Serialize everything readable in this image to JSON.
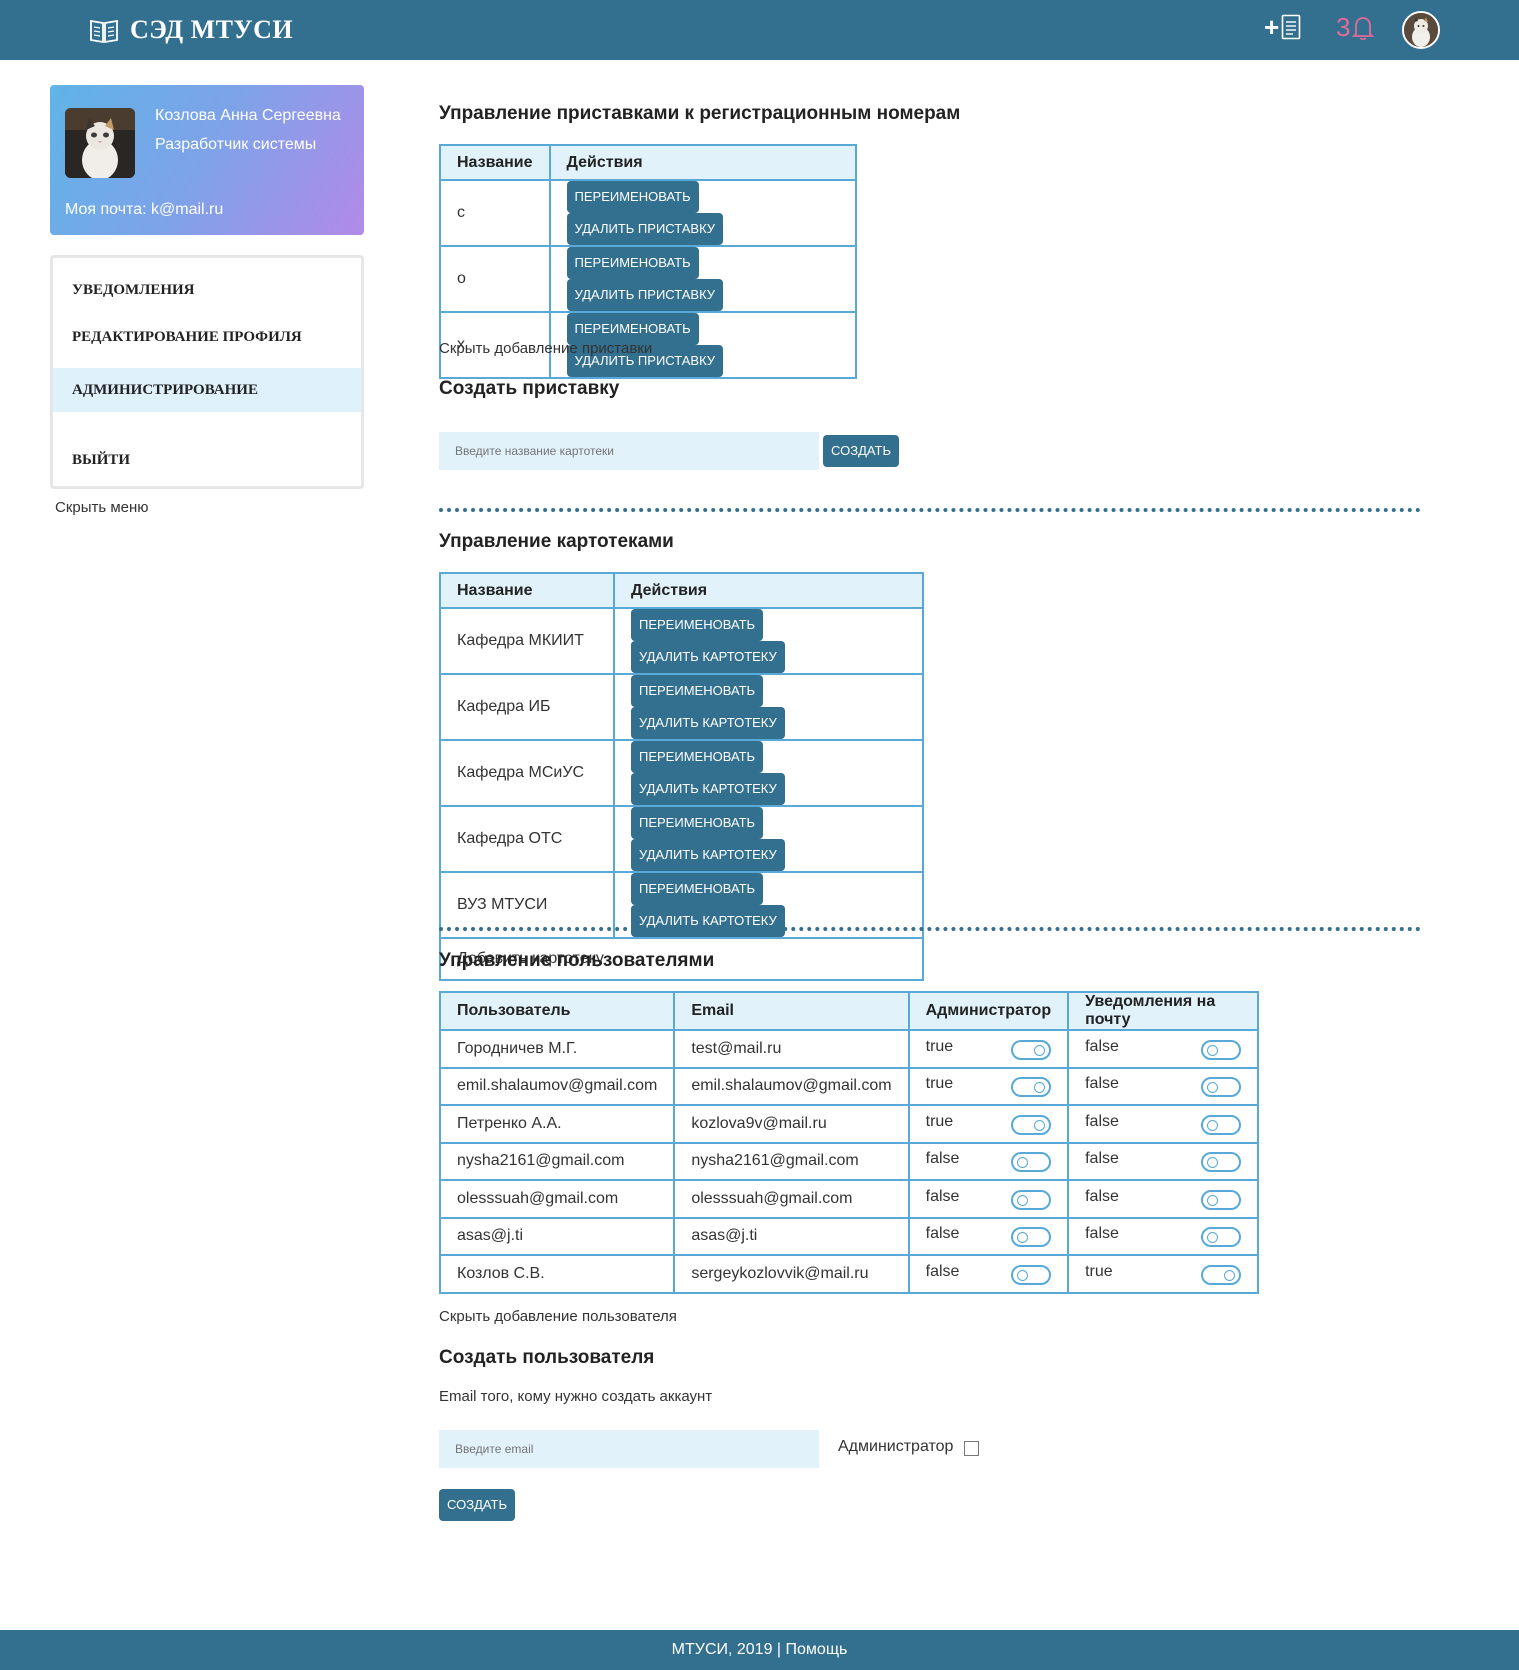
{
  "header": {
    "title": "СЭД МТУСИ",
    "add_icon": "document-plus-icon",
    "notifications_count": "3",
    "bell_icon": "bell-icon"
  },
  "profile": {
    "name": "Козлова Анна Сергеевна",
    "role": "Разработчик системы",
    "email": "Моя почта: k@mail.ru"
  },
  "menu": {
    "items": [
      {
        "label": "Уведомления"
      },
      {
        "label": "Редактирование профиля"
      },
      {
        "label": "Администрирование"
      },
      {
        "label": "Выйти"
      }
    ],
    "hide_label": "Скрыть меню"
  },
  "prefixes": {
    "title": "Управление приставками к регистрационным номерам",
    "col_name": "Название",
    "col_actions": "Действия",
    "rows": [
      {
        "name": "c",
        "rename": "Переименовать",
        "delete": "Удалить приставку"
      },
      {
        "name": "o",
        "rename": "Переименовать",
        "delete": "Удалить приставку"
      },
      {
        "name": "x",
        "rename": "Переименовать",
        "delete": "Удалить приставку"
      }
    ],
    "hide_add": "Скрыть добавление приставки",
    "create_title": "Создать приставку",
    "input_placeholder": "Введите название картотеки",
    "create_button": "Создать"
  },
  "cabinets": {
    "title": "Управление картотеками",
    "col_name": "Название",
    "col_actions": "Действия",
    "rows": [
      {
        "name": "Кафедра МКИИТ",
        "rename": "Переименовать",
        "delete": "Удалить картотеку"
      },
      {
        "name": "Кафедра ИБ",
        "rename": "Переименовать",
        "delete": "Удалить картотеку"
      },
      {
        "name": "Кафедра МСиУС",
        "rename": "Переименовать",
        "delete": "Удалить картотеку"
      },
      {
        "name": "Кафедра ОТС",
        "rename": "Переименовать",
        "delete": "Удалить картотеку"
      },
      {
        "name": "ВУЗ МТУСИ",
        "rename": "Переименовать",
        "delete": "Удалить картотеку"
      }
    ],
    "add_label": "Добавить картотеку"
  },
  "users": {
    "title": "Управление пользователями",
    "columns": [
      "Пользователь",
      "Email",
      "Администратор",
      "Уведомления на почту"
    ],
    "rows": [
      {
        "user": "Городничев М.Г.",
        "email": "test@mail.ru",
        "admin": "true",
        "notify": "false"
      },
      {
        "user": "emil.shalaumov@gmail.com",
        "email": "emil.shalaumov@gmail.com",
        "admin": "true",
        "notify": "false"
      },
      {
        "user": "Петренко А.А.",
        "email": "kozlova9v@mail.ru",
        "admin": "true",
        "notify": "false"
      },
      {
        "user": "nysha2161@gmail.com",
        "email": "nysha2161@gmail.com",
        "admin": "false",
        "notify": "false"
      },
      {
        "user": "olesssuah@gmail.com",
        "email": "olesssuah@gmail.com",
        "admin": "false",
        "notify": "false"
      },
      {
        "user": "asas@j.ti",
        "email": "asas@j.ti",
        "admin": "false",
        "notify": "false"
      },
      {
        "user": "Козлов С.В.",
        "email": "sergeykozlovvik@mail.ru",
        "admin": "false",
        "notify": "true"
      }
    ],
    "hide_add": "Скрыть добавление пользователя",
    "create_title": "Создать пользователя",
    "email_hint": "Email того, кому нужно создать аккаунт",
    "email_placeholder": "Введите email",
    "admin_label": "Администратор",
    "create_button": "Создать"
  },
  "footer": {
    "text": "МТУСИ, 2019 | Помощь"
  }
}
